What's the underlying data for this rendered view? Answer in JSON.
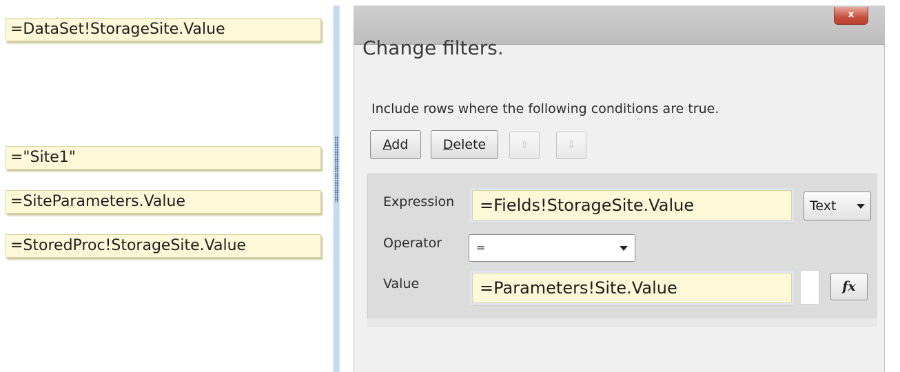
{
  "answer_tiles": [
    "=DataSet!StorageSite.Value",
    "=\"Site1\"",
    "=SiteParameters.Value",
    "=StoredProc!StorageSite.Value"
  ],
  "dialog": {
    "close_glyph": "x",
    "heading": "Change filters.",
    "instruction": "Include rows where the following conditions are true.",
    "buttons": {
      "add_label": "Add",
      "add_accel": "A",
      "add_rest": "dd",
      "delete_accel": "D",
      "delete_rest": "elete",
      "move_up_glyph": "⇧",
      "move_down_glyph": "⇩"
    },
    "condition": {
      "expression_label": "Expression",
      "expression_value": "=Fields!StorageSite.Value",
      "type_value": "Text",
      "operator_label": "Operator",
      "operator_value": "=",
      "value_label": "Value",
      "value_value": "=Parameters!Site.Value",
      "fx_label": "fx"
    }
  }
}
